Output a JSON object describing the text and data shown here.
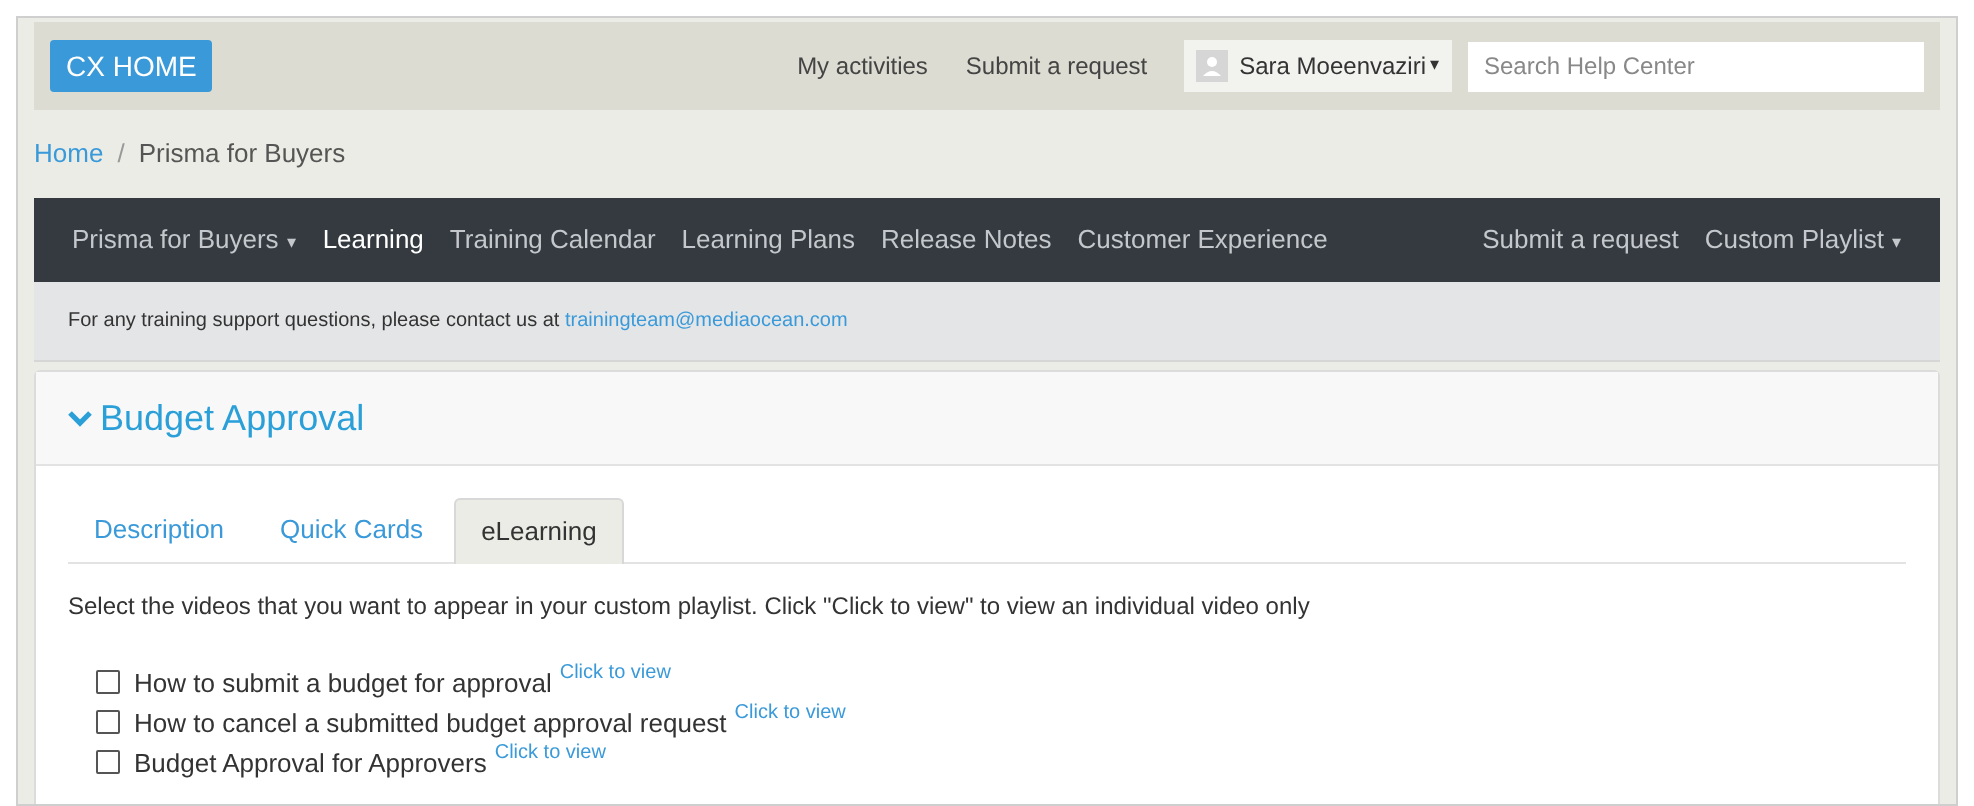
{
  "header": {
    "home_button": "CX HOME",
    "links": [
      "My activities",
      "Submit a request"
    ],
    "user": {
      "name": "Sara Moeenvaziri",
      "caret": "▾"
    },
    "search": {
      "placeholder": "Search Help Center"
    }
  },
  "breadcrumb": [
    {
      "label": "Home",
      "link": true
    },
    {
      "label": "/",
      "link": false
    },
    {
      "label": "Prisma for Buyers",
      "link": false
    }
  ],
  "nav": {
    "left": [
      {
        "label": "Prisma for Buyers",
        "caret": "▾",
        "selected": false
      },
      {
        "label": "Learning",
        "selected": true
      },
      {
        "label": "Training Calendar",
        "selected": false
      },
      {
        "label": "Learning Plans",
        "selected": false
      },
      {
        "label": "Release Notes",
        "selected": false
      },
      {
        "label": "Customer Experience",
        "selected": false
      }
    ],
    "right": [
      {
        "label": "Submit a request",
        "selected": false
      },
      {
        "label": "Custom Playlist",
        "caret": "▾",
        "selected": false
      }
    ]
  },
  "notice": {
    "text": "For any training support questions, please contact us at",
    "email": "trainingteam@mediaocean.com"
  },
  "section": {
    "title": "Budget Approval",
    "expanded": true,
    "tabs": [
      {
        "label": "Description",
        "selected": false
      },
      {
        "label": "Quick Cards",
        "selected": false
      },
      {
        "label": "eLearning",
        "selected": true
      }
    ],
    "instructions": "Select the videos that you want to appear in your custom playlist. Click \"Click to view\" to view an individual video only",
    "videos": [
      {
        "title": "How to submit a budget for approval",
        "link": "Click to view",
        "checked": false
      },
      {
        "title": "How to cancel a submitted budget approval request",
        "link": "Click to view",
        "checked": false
      },
      {
        "title": "Budget Approval for Approvers",
        "link": "Click to view",
        "checked": false
      }
    ]
  }
}
